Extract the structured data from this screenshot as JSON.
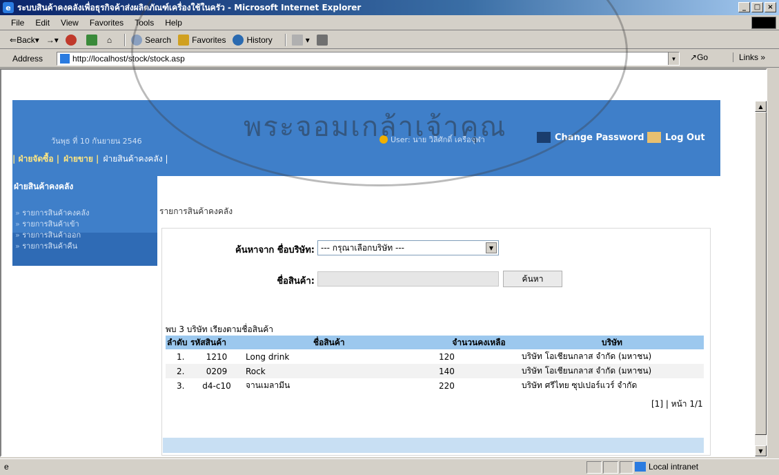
{
  "window": {
    "title": "ระบบสินค้าคงคลังเพื่อธุรกิจค้าส่งผลิตภัณฑ์เครื่องใช้ในครัว - Microsoft Internet Explorer",
    "minimize": "_",
    "maximize": "□",
    "close": "×"
  },
  "menu": [
    "File",
    "Edit",
    "View",
    "Favorites",
    "Tools",
    "Help"
  ],
  "toolbar": {
    "back": "Back",
    "forward": "→",
    "search": "Search",
    "favorites": "Favorites",
    "history": "History"
  },
  "address": {
    "label": "Address",
    "url": "http://localhost/stock/stock.asp",
    "go": "Go",
    "links": "Links »"
  },
  "header": {
    "date": "วันพุธ ที่ 10 กันยายน 2546",
    "user": "User: นาย วิลิศักดิ์ เครือจุฬา",
    "change_password": "Change Password",
    "logout": "Log Out",
    "tabs": [
      "| ฝ่ายจัดซื้อ |",
      "ฝ่ายขาย |",
      "ฝ่ายสินค้าคงคลัง |"
    ]
  },
  "sidebar": {
    "title": "ฝ่ายสินค้าคงคลัง",
    "items": [
      "รายการสินค้าคงคลัง",
      "รายการสินค้าเข้า",
      "รายการสินค้าออก",
      "รายการสินค้าคืน"
    ]
  },
  "main": {
    "breadcrumb": "รายการสินค้าคงคลัง",
    "search_from_label": "ค้นหาจาก ชื่อบริษัท:",
    "company_select": "--- กรุณาเลือกบริษัท ---",
    "product_label": "ชื่อสินค้า:",
    "product_value": "",
    "search_button": "ค้นหา",
    "found_text": "พบ 3 บริษัท เรียงตามชื่อสินค้า",
    "columns": [
      "ลำดับ",
      "รหัสสินค้า",
      "ชื่อสินค้า",
      "จำนวนคงเหลือ",
      "บริษัท"
    ],
    "rows": [
      {
        "no": "1.",
        "code": "1210",
        "name": "Long drink",
        "qty": "120",
        "company": "บริษัท โอเชียนกลาส จำกัด (มหาชน)"
      },
      {
        "no": "2.",
        "code": "0209",
        "name": "Rock",
        "qty": "140",
        "company": "บริษัท โอเชียนกลาส จำกัด (มหาชน)"
      },
      {
        "no": "3.",
        "code": "d4-c10",
        "name": "จานเมลามีน",
        "qty": "220",
        "company": "บริษัท ศรีไทย ซุปเปอร์แวร์ จำกัด"
      }
    ],
    "pager": "[1] | หน้า 1/1"
  },
  "status": {
    "zone": "Local intranet"
  },
  "watermark": "พระจอมเกล้าเจ้าคุณ"
}
